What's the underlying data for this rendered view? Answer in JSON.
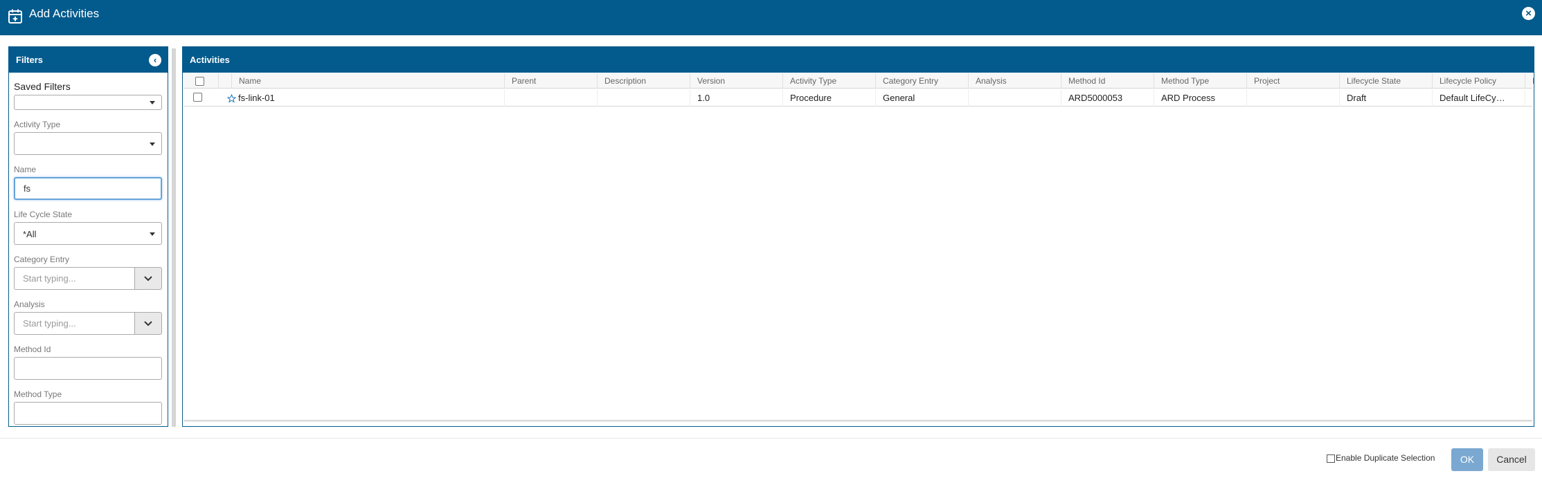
{
  "dialog": {
    "title": "Add Activities",
    "close_icon": "close-icon",
    "title_icon": "calendar-add-icon",
    "header_color": "#035a8c"
  },
  "filters": {
    "title": "Filters",
    "saved_filters_label": "Saved Filters",
    "saved_filters_value": "",
    "activity_type_label": "Activity Type",
    "activity_type_value": "",
    "name_label": "Name",
    "name_value": "fs",
    "lifecycle_label": "Life Cycle State",
    "lifecycle_value": "*All",
    "category_label": "Category Entry",
    "category_placeholder": "Start typing...",
    "analysis_label": "Analysis",
    "analysis_placeholder": "Start typing...",
    "method_id_label": "Method Id",
    "method_id_value": "",
    "method_type_label": "Method Type",
    "method_type_value": ""
  },
  "activities": {
    "title": "Activities",
    "columns": [
      "Name",
      "Parent",
      "Description",
      "Version",
      "Activity Type",
      "Category Entry",
      "Analysis",
      "Method Id",
      "Method Type",
      "Project",
      "Lifecycle State",
      "Lifecycle Policy",
      "I"
    ],
    "rows": [
      {
        "name": "fs-link-01",
        "parent": "",
        "description": "",
        "version": "1.0",
        "activity_type": "Procedure",
        "category_entry": "General",
        "analysis": "",
        "method_id": "ARD5000053",
        "method_type": "ARD Process",
        "project": "",
        "lifecycle_state": "Draft",
        "lifecycle_policy": "Default LifeCy…",
        "extra": ""
      }
    ]
  },
  "footer": {
    "duplicate_label": "Enable Duplicate Selection",
    "ok_label": "OK",
    "cancel_label": "Cancel"
  }
}
